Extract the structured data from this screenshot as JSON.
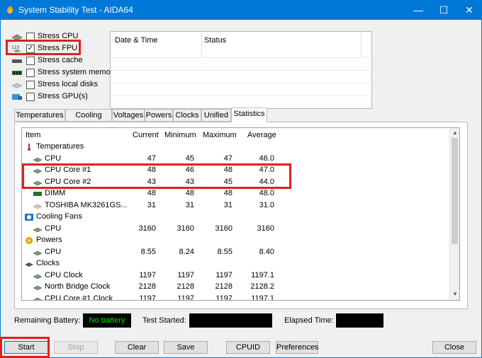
{
  "window": {
    "title": "System Stability Test - AIDA64",
    "minimize": "—",
    "maximize": "☐",
    "close": "✕"
  },
  "stress_options": [
    {
      "label": "Stress CPU",
      "checked": false,
      "icon": "cpu-icon"
    },
    {
      "label": "Stress FPU",
      "checked": true,
      "icon": "fpu-icon"
    },
    {
      "label": "Stress cache",
      "checked": false,
      "icon": "cache-icon"
    },
    {
      "label": "Stress system memory",
      "checked": false,
      "icon": "memory-icon"
    },
    {
      "label": "Stress local disks",
      "checked": false,
      "icon": "disk-icon"
    },
    {
      "label": "Stress GPU(s)",
      "checked": false,
      "icon": "gpu-icon"
    }
  ],
  "log": {
    "col_datetime": "Date & Time",
    "col_status": "Status"
  },
  "tabs": [
    "Temperatures",
    "Cooling Fans",
    "Voltages",
    "Powers",
    "Clocks",
    "Unified",
    "Statistics"
  ],
  "active_tab": "Statistics",
  "stats": {
    "headers": {
      "item": "Item",
      "current": "Current",
      "minimum": "Minimum",
      "maximum": "Maximum",
      "average": "Average"
    },
    "rows": [
      {
        "type": "group",
        "label": "Temperatures",
        "icon": "thermometer-icon"
      },
      {
        "type": "item",
        "label": "CPU",
        "current": "47",
        "minimum": "45",
        "maximum": "47",
        "average": "46.0",
        "icon": "chip-icon"
      },
      {
        "type": "item",
        "label": "CPU Core #1",
        "current": "48",
        "minimum": "46",
        "maximum": "48",
        "average": "47.0",
        "icon": "chip-icon"
      },
      {
        "type": "item",
        "label": "CPU Core #2",
        "current": "43",
        "minimum": "43",
        "maximum": "45",
        "average": "44.0",
        "icon": "chip-icon"
      },
      {
        "type": "item",
        "label": "DIMM",
        "current": "48",
        "minimum": "48",
        "maximum": "48",
        "average": "48.0",
        "icon": "memory-module-icon"
      },
      {
        "type": "item",
        "label": "TOSHIBA MK3261GS...",
        "current": "31",
        "minimum": "31",
        "maximum": "31",
        "average": "31.0",
        "icon": "hard-disk-icon"
      },
      {
        "type": "group",
        "label": "Cooling Fans",
        "icon": "fan-icon"
      },
      {
        "type": "item",
        "label": "CPU",
        "current": "3160",
        "minimum": "3160",
        "maximum": "3160",
        "average": "3160",
        "icon": "chip-icon"
      },
      {
        "type": "group",
        "label": "Powers",
        "icon": "power-icon"
      },
      {
        "type": "item",
        "label": "CPU",
        "current": "8.55",
        "minimum": "8.24",
        "maximum": "8.55",
        "average": "8.40",
        "icon": "chip-icon"
      },
      {
        "type": "group",
        "label": "Clocks",
        "icon": "clock-icon"
      },
      {
        "type": "item",
        "label": "CPU Clock",
        "current": "1197",
        "minimum": "1197",
        "maximum": "1197",
        "average": "1197.1",
        "icon": "chip-icon"
      },
      {
        "type": "item",
        "label": "North Bridge Clock",
        "current": "2128",
        "minimum": "2128",
        "maximum": "2128",
        "average": "2128.2",
        "icon": "chip-icon"
      },
      {
        "type": "item",
        "label": "CPU Core #1 Clock",
        "current": "1197",
        "minimum": "1197",
        "maximum": "1197",
        "average": "1197.1",
        "icon": "chip-icon"
      }
    ]
  },
  "status": {
    "battery_label": "Remaining Battery:",
    "battery_value": "No battery",
    "started_label": "Test Started:",
    "started_value": "",
    "elapsed_label": "Elapsed Time:",
    "elapsed_value": ""
  },
  "buttons": {
    "start": "Start",
    "stop": "Stop",
    "clear": "Clear",
    "save": "Save",
    "cpuid": "CPUID",
    "preferences": "Preferences",
    "close": "Close"
  },
  "colors": {
    "titlebar": "#0078d7",
    "highlight": "#e02020",
    "battery_text": "#00e000"
  }
}
